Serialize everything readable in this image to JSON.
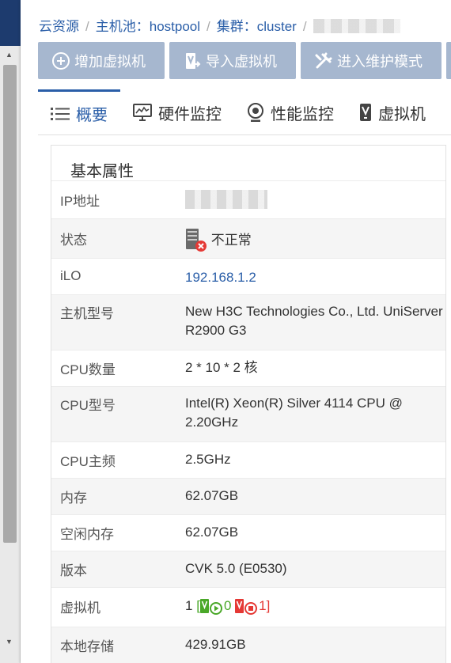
{
  "breadcrumb": {
    "items": [
      "云资源",
      "主机池：hostpool",
      "集群：cluster"
    ]
  },
  "toolbar": {
    "add_vm": "增加虚拟机",
    "import_vm": "导入虚拟机",
    "maintenance": "进入维护模式"
  },
  "tabs": [
    {
      "label": "概要",
      "icon": "list-icon",
      "active": true
    },
    {
      "label": "硬件监控",
      "icon": "monitor-chart-icon",
      "active": false
    },
    {
      "label": "性能监控",
      "icon": "webcam-icon",
      "active": false
    },
    {
      "label": "虚拟机",
      "icon": "vm-icon",
      "active": false
    }
  ],
  "panel": {
    "title": "基本属性",
    "rows": [
      {
        "key": "IP地址",
        "value": ""
      },
      {
        "key": "状态",
        "value": "不正常"
      },
      {
        "key": "iLO",
        "value": "192.168.1.2"
      },
      {
        "key": "主机型号",
        "value": "New H3C Technologies Co., Ltd. UniServer R2900 G3"
      },
      {
        "key": "CPU数量",
        "value": "2 * 10 * 2 核"
      },
      {
        "key": "CPU型号",
        "value": "Intel(R) Xeon(R) Silver 4114 CPU @ 2.20GHz"
      },
      {
        "key": "CPU主频",
        "value": "2.5GHz"
      },
      {
        "key": "内存",
        "value": "62.07GB"
      },
      {
        "key": "空闲内存",
        "value": "62.07GB"
      },
      {
        "key": "版本",
        "value": "CVK 5.0 (E0530)"
      },
      {
        "key": "虚拟机",
        "value": "1",
        "running": "0",
        "stopped": "1"
      },
      {
        "key": "本地存储",
        "value": "429.91GB"
      }
    ]
  },
  "colors": {
    "accent": "#2a5ea8",
    "topbar": "#1d3b6e",
    "button": "#a6b7cf",
    "ok_green": "#4aa829",
    "error_red": "#e53935"
  }
}
